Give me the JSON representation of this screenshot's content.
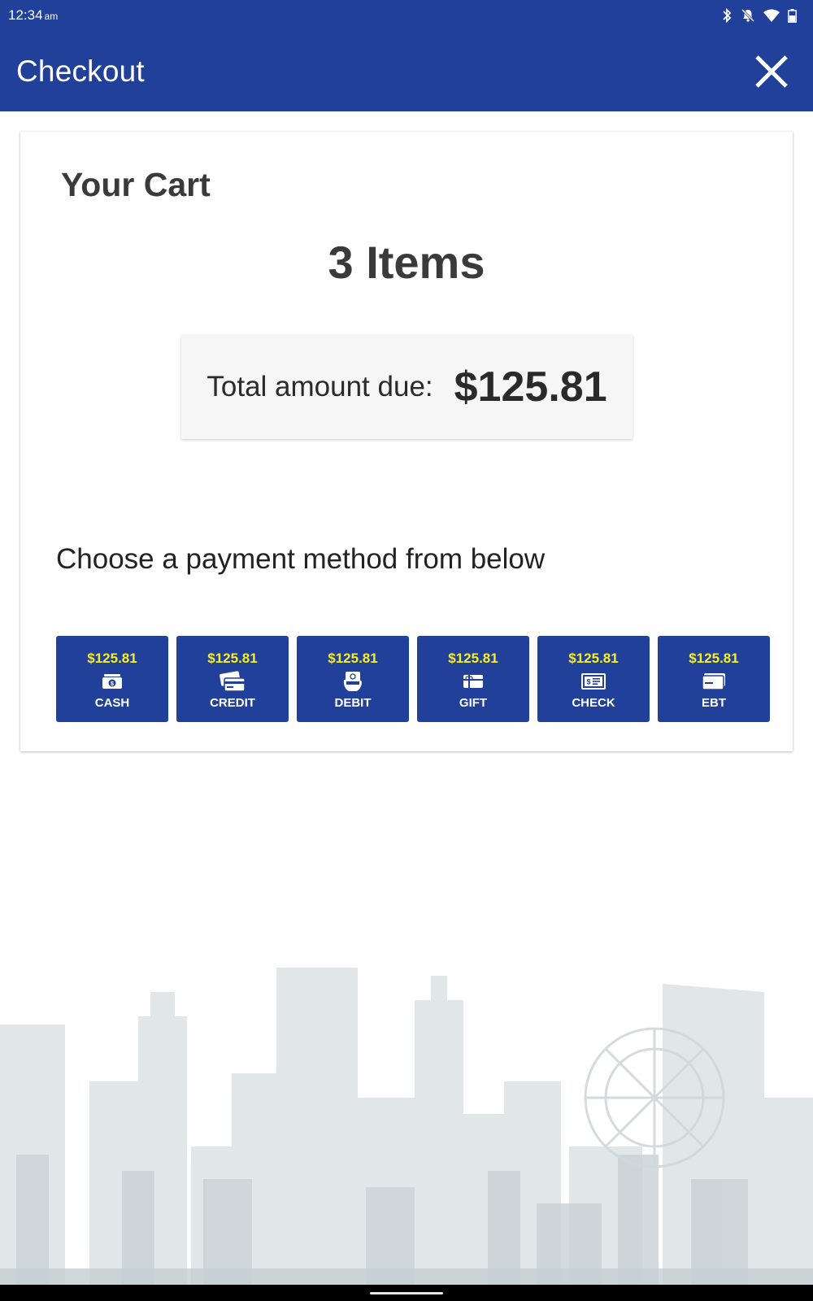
{
  "status_bar": {
    "time": "12:34",
    "ampm": "am",
    "icons": [
      "bluetooth-icon",
      "notifications-off-icon",
      "wifi-icon",
      "battery-icon"
    ]
  },
  "app_bar": {
    "title": "Checkout",
    "close_icon": "close-icon"
  },
  "cart": {
    "heading": "Your Cart",
    "items_count": "3 Items",
    "total_label": "Total amount due:",
    "total_amount": "$125.81",
    "choose_prompt": "Choose a payment method from below"
  },
  "payment_methods": [
    {
      "amount": "$125.81",
      "label": "CASH",
      "icon": "cash-icon"
    },
    {
      "amount": "$125.81",
      "label": "CREDIT",
      "icon": "credit-card-icon"
    },
    {
      "amount": "$125.81",
      "label": "DEBIT",
      "icon": "debit-card-icon"
    },
    {
      "amount": "$125.81",
      "label": "GIFT",
      "icon": "gift-card-icon"
    },
    {
      "amount": "$125.81",
      "label": "CHECK",
      "icon": "check-icon"
    },
    {
      "amount": "$125.81",
      "label": "EBT",
      "icon": "ebt-card-icon"
    }
  ],
  "colors": {
    "primary": "#21409a",
    "amount_highlight": "#f7ee2a",
    "card_background": "#ffffff",
    "total_box_background": "#f6f6f6"
  }
}
